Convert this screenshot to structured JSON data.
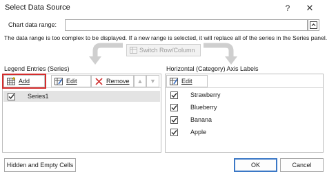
{
  "window": {
    "title": "Select Data Source",
    "help_label": "?",
    "close_label": "✕"
  },
  "range": {
    "label": "Chart data range:",
    "value": ""
  },
  "message": "The data range is too complex to be displayed. If a new range is selected, it will replace all of the series in the Series panel.",
  "switch_button": "Switch Row/Column",
  "legend": {
    "label": "Legend Entries (Series)",
    "add": "Add",
    "edit": "Edit",
    "remove": "Remove",
    "up": "▲",
    "down": "▼",
    "series": [
      {
        "name": "Series1",
        "checked": true
      }
    ]
  },
  "axis": {
    "label": "Horizontal (Category) Axis Labels",
    "edit": "Edit",
    "items": [
      {
        "name": "Strawberry",
        "checked": true
      },
      {
        "name": "Blueberry",
        "checked": true
      },
      {
        "name": "Banana",
        "checked": true
      },
      {
        "name": "Apple",
        "checked": true
      }
    ]
  },
  "buttons": {
    "hidden_empty": "Hidden and Empty Cells",
    "ok": "OK",
    "cancel": "Cancel"
  },
  "colors": {
    "highlight": "#d42c2c",
    "ok_border": "#3b78c6"
  }
}
